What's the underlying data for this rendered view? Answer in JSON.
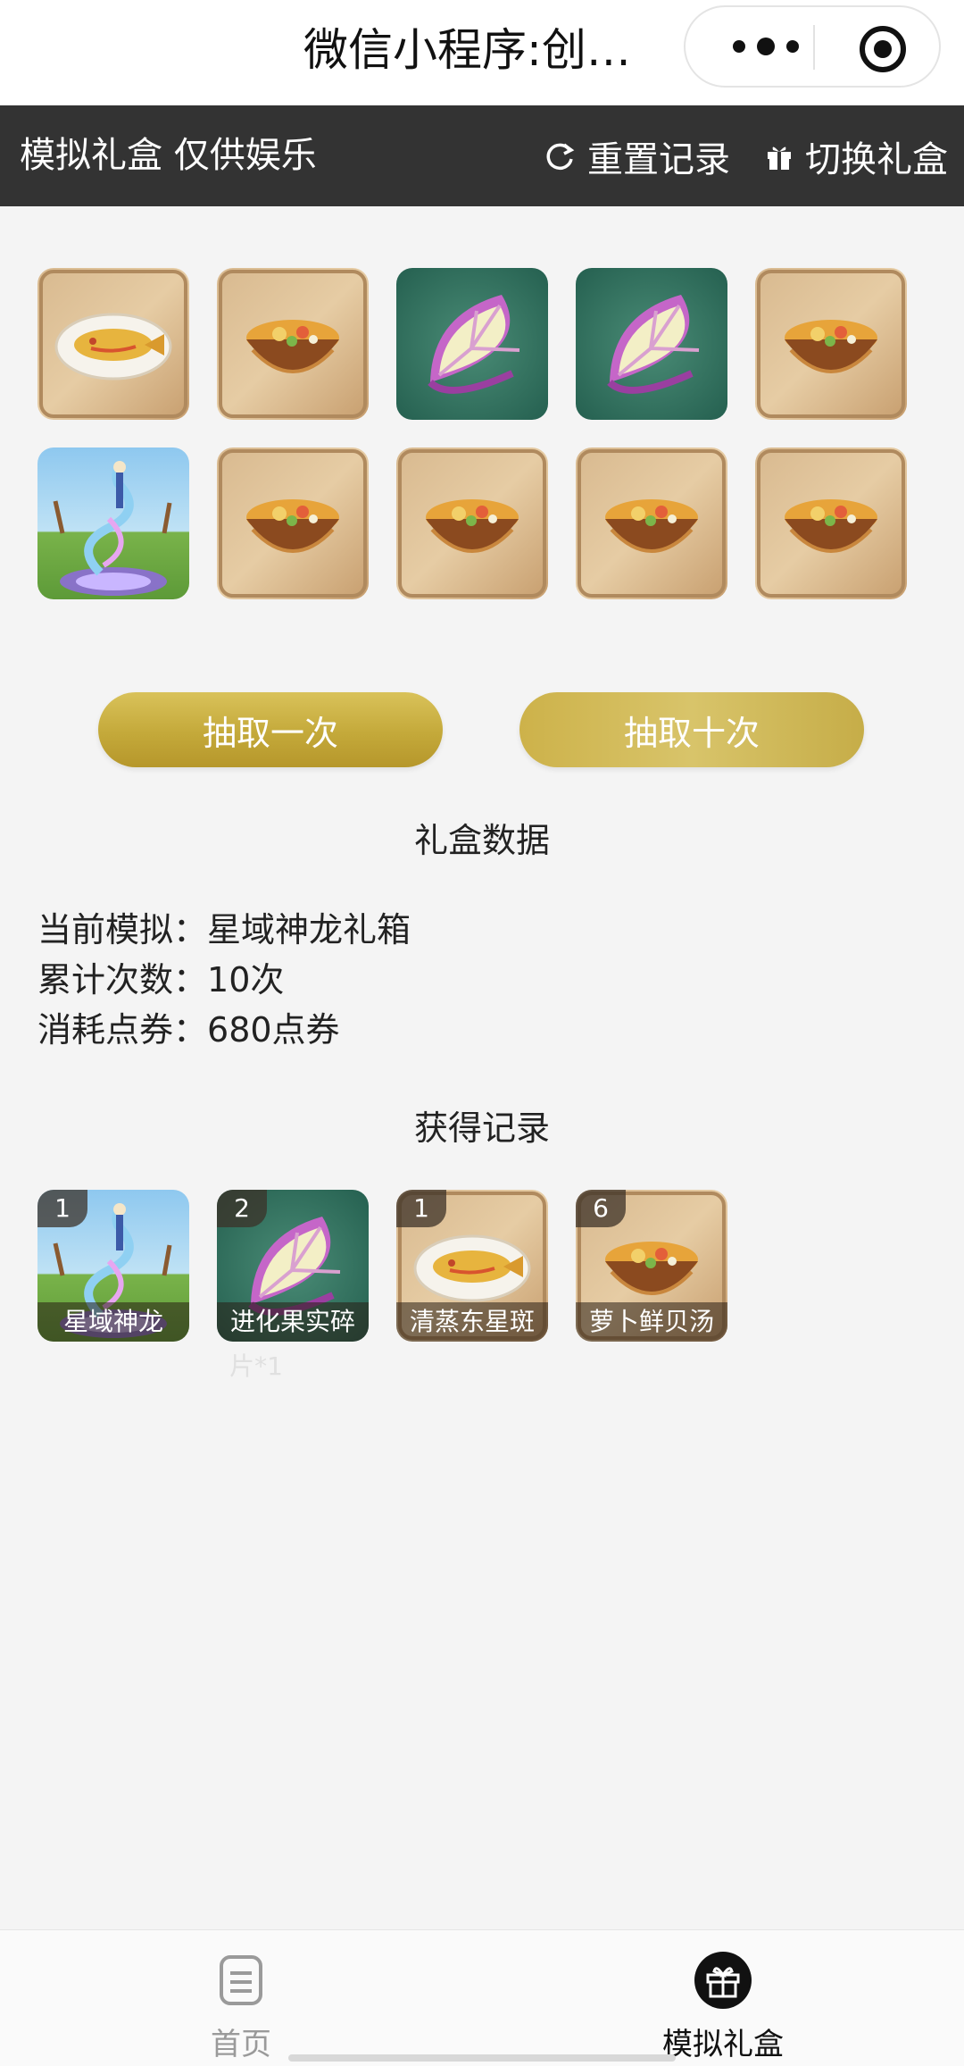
{
  "wechat": {
    "title": "微信小程序:创…",
    "more_icon": "more-dots-icon",
    "close_icon": "target-close-icon"
  },
  "header": {
    "title": "模拟礼盒 仅供娱乐",
    "reset_label": "重置记录",
    "switch_label": "切换礼盒"
  },
  "result_tiles": [
    "fish-dish",
    "soup-bowl",
    "fruit-fragment",
    "fruit-fragment",
    "soup-bowl",
    "dragon-mount",
    "soup-bowl",
    "soup-bowl",
    "soup-bowl",
    "soup-bowl"
  ],
  "buttons": {
    "draw_once": "抽取一次",
    "draw_ten": "抽取十次"
  },
  "stats": {
    "section_title": "礼盒数据",
    "current_label": "当前模拟：",
    "current_value": "星域神龙礼箱",
    "total_label": "累计次数：",
    "total_value": "10次",
    "cost_label": "消耗点券：",
    "cost_value": "680点券"
  },
  "records": {
    "section_title": "获得记录",
    "items": [
      {
        "count": "1",
        "name": "星域神龙",
        "icon": "dragon-mount"
      },
      {
        "count": "2",
        "name": "进化果实碎",
        "icon": "fruit-fragment"
      },
      {
        "count": "1",
        "name": "清蒸东星斑",
        "icon": "fish-dish"
      },
      {
        "count": "6",
        "name": "萝卜鲜贝汤",
        "icon": "soup-bowl"
      }
    ],
    "overflow_text": "片*1"
  },
  "tabbar": {
    "home_label": "首页",
    "gift_label": "模拟礼盒"
  },
  "colors": {
    "header_bg": "#333333",
    "gold": "#c9ad44",
    "page_bg": "#f4f4f4",
    "teal": "#2f6a5a"
  }
}
